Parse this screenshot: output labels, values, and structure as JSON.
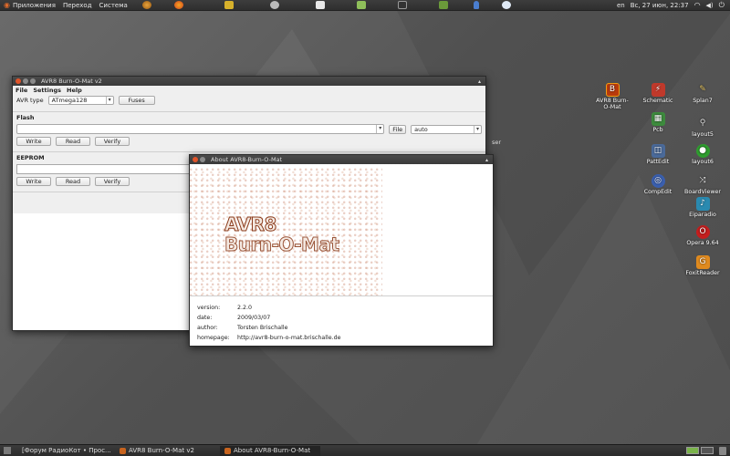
{
  "top_panel": {
    "menu": [
      "Приложения",
      "Переход",
      "Система"
    ],
    "keyboard_layout": "en",
    "clock": "Вс, 27 июн, 22:37"
  },
  "desktop_icons": [
    {
      "label": "AVR8 Burn-O-Mat",
      "icon": "avr8-icon",
      "color": "#b83a0c"
    },
    {
      "label": "Schematic",
      "icon": "schematic-icon",
      "color": "#c0392b"
    },
    {
      "label": "Splan7",
      "icon": "pencil-icon",
      "color": "#7a5a2a"
    },
    {
      "label": "Pcb",
      "icon": "pcb-icon",
      "color": "#3d8b3d"
    },
    {
      "label": "layout5",
      "icon": "layout-icon",
      "color": "#5a5a8a"
    },
    {
      "label": "PattEdit",
      "icon": "pattedit-icon",
      "color": "#4a6a9a"
    },
    {
      "label": "layout6",
      "icon": "layout-icon",
      "color": "#2f9e2f"
    },
    {
      "label": "CompEdit",
      "icon": "compedit-icon",
      "color": "#3a5fae"
    },
    {
      "label": "BoardViewer",
      "icon": "shuffle-icon",
      "color": "#555"
    },
    {
      "label": "Eiparadio",
      "icon": "eiparadio-icon",
      "color": "#2a8ab0"
    },
    {
      "label": "Opera 9.64",
      "icon": "opera-icon",
      "color": "#c41e1e"
    },
    {
      "label": "FoxitReader",
      "icon": "foxit-icon",
      "color": "#e08a1e"
    }
  ],
  "main_window": {
    "title": "AVR8 Burn-O-Mat v2",
    "menu": [
      "File",
      "Settings",
      "Help"
    ],
    "avr_type_label": "AVR type",
    "avr_type_value": "ATmega128",
    "fuses_label": "Fuses",
    "flash_label": "Flash",
    "flash_file_button": "File",
    "flash_format": "auto",
    "flash_buttons": [
      "Write",
      "Read",
      "Verify"
    ],
    "eeprom_label": "EEPROM",
    "eeprom_buttons": [
      "Write",
      "Read",
      "Verify"
    ],
    "partial_text_behind": "ser"
  },
  "about_window": {
    "title": "About AVR8-Burn-O-Mat",
    "logo_text_line1": "AVR8",
    "logo_text_line2": "Burn-O-Mat",
    "info": [
      {
        "key": "version:",
        "value": "2.2.0"
      },
      {
        "key": "date:",
        "value": "2009/03/07"
      },
      {
        "key": "author:",
        "value": "Torsten Brischalle"
      },
      {
        "key": "homepage:",
        "value": "http://avr8-burn-o-mat.brischalle.de"
      }
    ]
  },
  "taskbar": [
    {
      "label": "[Форум РадиоКот • Прос...",
      "color": "#d35400"
    },
    {
      "label": "AVR8 Burn-O-Mat v2",
      "color": "#c8641e"
    },
    {
      "label": "About AVR8-Burn-O-Mat",
      "color": "#c8641e"
    }
  ]
}
